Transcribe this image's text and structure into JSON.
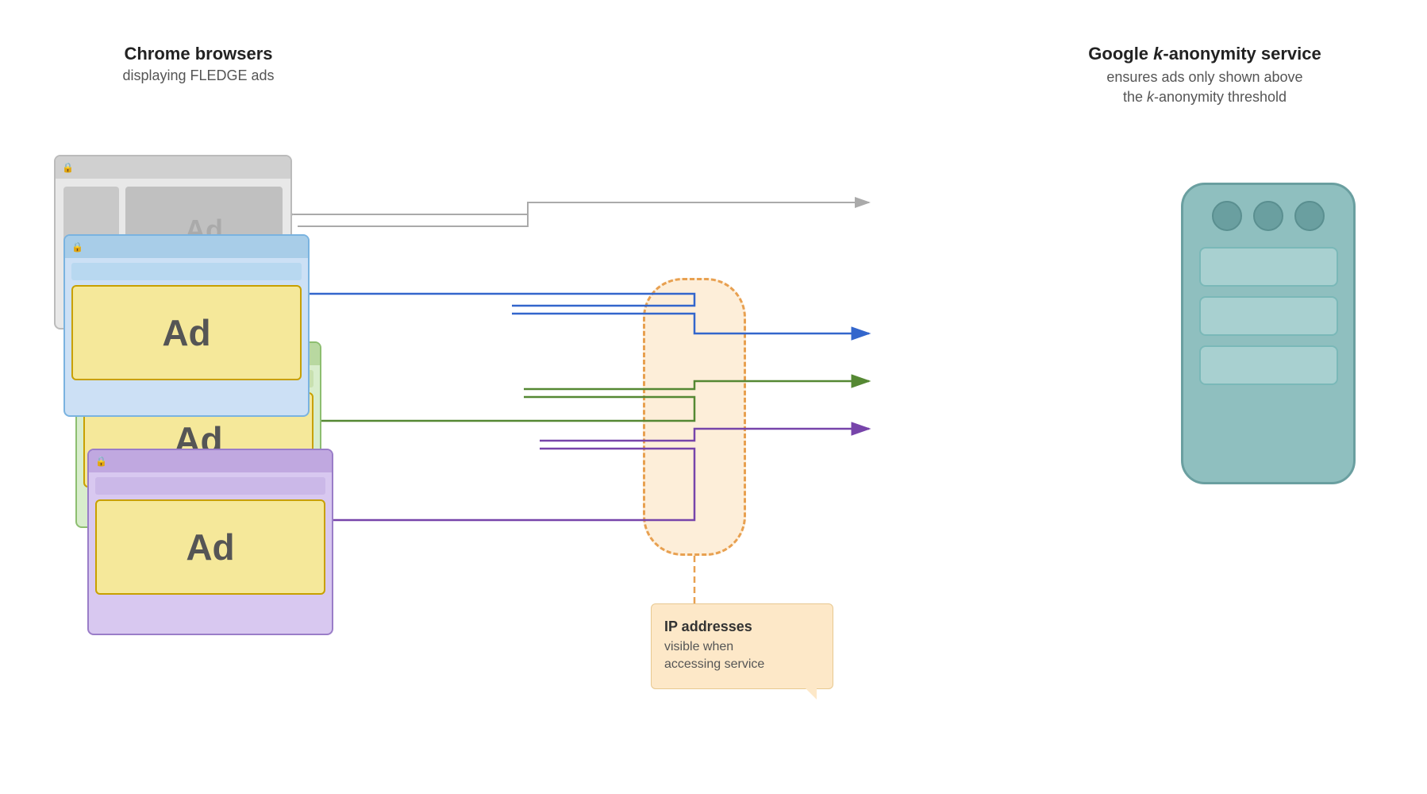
{
  "labels": {
    "chrome_title": "Chrome browsers",
    "chrome_subtitle": "displaying FLEDGE ads",
    "google_title": "Google k-anonymity service",
    "google_subtitle": "ensures ads only shown above\nthe k-anonymity threshold",
    "ad_text": "Ad",
    "ip_title": "IP addresses",
    "ip_subtitle": "visible when\naccessing service"
  },
  "colors": {
    "gray_border": "#bbb",
    "blue_border": "#7ab3e0",
    "green_border": "#8dbe70",
    "purple_border": "#9a7dc8",
    "arrow_gray": "#aaa",
    "arrow_blue": "#3366cc",
    "arrow_green": "#558833",
    "arrow_purple": "#7744aa",
    "server_bg": "#8fbfbf",
    "ip_bg": "#fde8c8",
    "ip_dashed": "#e8a050"
  }
}
